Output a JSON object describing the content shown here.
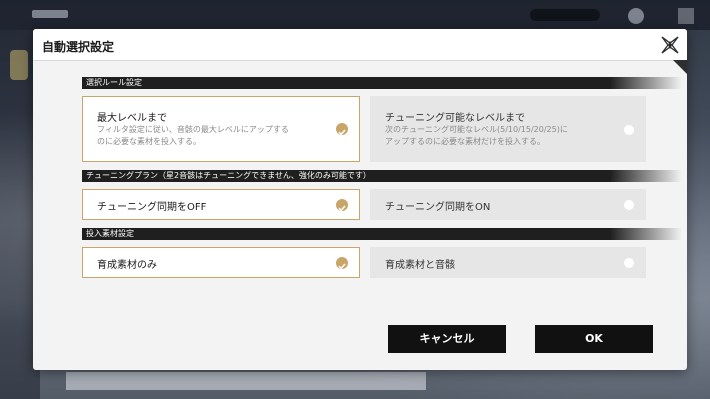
{
  "dialog": {
    "title": "自動選択設定",
    "close_icon": "close-x-icon"
  },
  "sections": {
    "rule": {
      "label": "選択ルール設定",
      "options": [
        {
          "title": "最大レベルまで",
          "desc_line1": "フィルタ設定に従い、音骸の最大レベルにアップする",
          "desc_line2": "のに必要な素材を投入する。",
          "selected": true
        },
        {
          "title": "チューニング可能なレベルまで",
          "desc_line1": "次のチューニング可能なレベル(5/10/15/20/25)に",
          "desc_line2": "アップするのに必要な素材だけを投入する。",
          "selected": false
        }
      ]
    },
    "tuning": {
      "label": "チューニングプラン（星2音骸はチューニングできません、強化のみ可能です）",
      "options": [
        {
          "title": "チューニング同期をOFF",
          "selected": true
        },
        {
          "title": "チューニング同期をON",
          "selected": false
        }
      ]
    },
    "material": {
      "label": "投入素材設定",
      "options": [
        {
          "title": "育成素材のみ",
          "selected": true
        },
        {
          "title": "育成素材と音骸",
          "selected": false
        }
      ]
    }
  },
  "buttons": {
    "cancel": "キャンセル",
    "ok": "OK"
  },
  "colors": {
    "accent_gold": "#c9a56a",
    "section_bar": "#1f1f1f",
    "button_bg": "#111111",
    "selected_bg": "#ffffff",
    "unselected_bg": "#e6e6e6"
  }
}
